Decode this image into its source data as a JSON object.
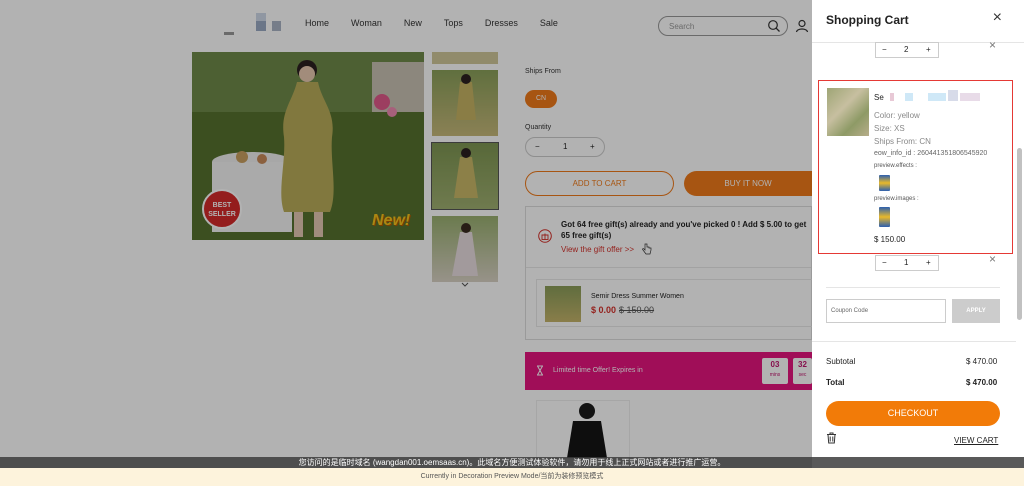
{
  "header": {
    "nav": [
      "Home",
      "Woman",
      "New",
      "Tops",
      "Dresses",
      "Sale"
    ],
    "search_placeholder": "Search"
  },
  "product": {
    "main_image_badges": {
      "best_seller": "BEST SELLER",
      "new": "New!"
    },
    "ships_from_label": "Ships From",
    "ships_from_option": "CN",
    "quantity_label": "Quantity",
    "quantity_value": "1",
    "add_to_cart": "ADD TO CART",
    "buy_it_now": "BUY IT NOW"
  },
  "gift": {
    "title": "Got 64 free gift(s) already and you've picked 0 ! Add $ 5.00 to get 65 free gift(s)",
    "link": "View the gift offer >>",
    "item_name": "Semir Dress Summer Women",
    "item_price": "$ 0.00",
    "item_original_price": "$ 150.00"
  },
  "limited": {
    "text": "Limited time Offer! Expires in",
    "timers": [
      {
        "value": "03",
        "unit": "mins"
      },
      {
        "value": "32",
        "unit": "sec"
      }
    ]
  },
  "cart": {
    "title": "Shopping Cart",
    "item1_qty": "2",
    "item2": {
      "name_prefix": "Se",
      "color": "Color: yellow",
      "size": "Size: XS",
      "ships_from": "Ships From: CN",
      "eow_info": "eow_info_id : 260441351806545920",
      "preview_effects": "preview.effects :",
      "preview_images": "preview.images :",
      "price": "$ 150.00"
    },
    "item3_qty": "1",
    "coupon_placeholder": "Coupon Code",
    "apply": "APPLY",
    "subtotal_label": "Subtotal",
    "subtotal_value": "$ 470.00",
    "total_label": "Total",
    "total_value": "$ 470.00",
    "checkout": "CHECKOUT",
    "view_cart": "VIEW CART"
  },
  "notice": "您访问的是临时域名 (wangdan001.oemsaas.cn)。此域名方便测试体验软件，请勿用于线上正式网站或者进行推广运营。",
  "preview_bar": "Currently in Decoration Preview Mode/当前为装修预览模式",
  "colors": {
    "accent": "#f07a1a",
    "limited_bg": "#e5157f",
    "highlight": "#e53935"
  }
}
